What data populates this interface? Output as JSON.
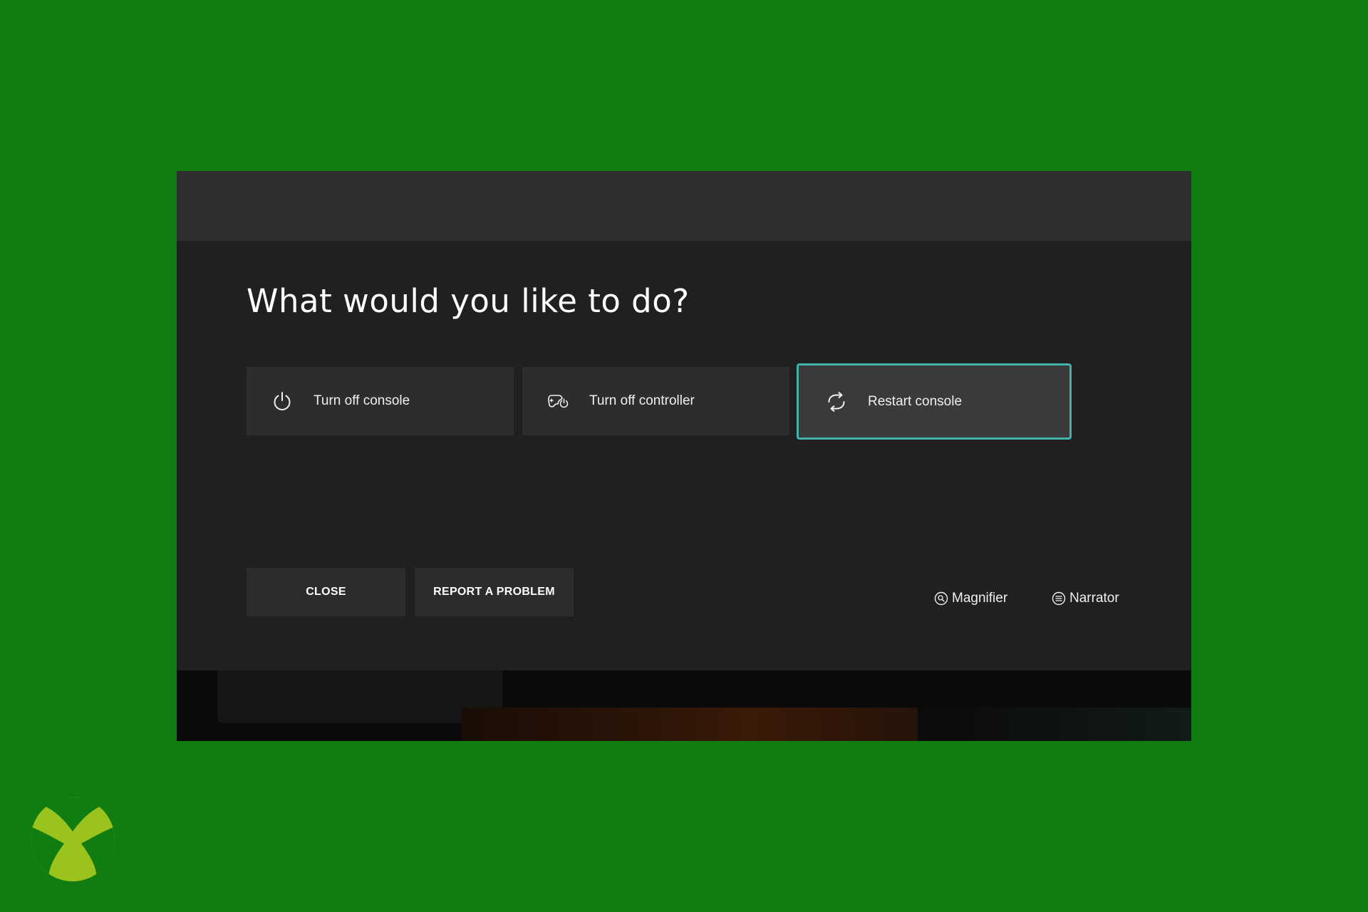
{
  "dialog": {
    "title": "What would you like to do?",
    "options": [
      {
        "label": "Turn off console",
        "icon": "power-icon"
      },
      {
        "label": "Turn off controller",
        "icon": "controller-power-icon"
      },
      {
        "label": "Restart console",
        "icon": "restart-icon",
        "selected": true
      }
    ],
    "buttons": {
      "close_label": "CLOSE",
      "report_label": "REPORT A PROBLEM"
    },
    "accessibility": {
      "magnifier_label": "Magnifier",
      "narrator_label": "Narrator"
    }
  },
  "logo": "xbox-logo-icon",
  "colors": {
    "background": "#117d10",
    "dialog": "#202020",
    "option": "#2d2d2d",
    "focus_border": "#3fb4ad",
    "logo": "#9bc31e"
  }
}
